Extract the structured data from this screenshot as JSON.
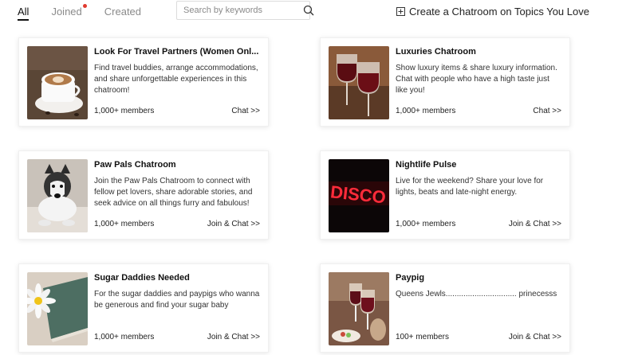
{
  "tabs": [
    {
      "label": "All",
      "active": true
    },
    {
      "label": "Joined",
      "has_notification": true
    },
    {
      "label": "Created"
    }
  ],
  "search": {
    "placeholder": "Search by keywords"
  },
  "create_button": {
    "label": "Create a Chatroom on Topics You Love"
  },
  "chatrooms": [
    {
      "title": "Look For Travel Partners (Women Onl...",
      "description": "Find travel buddies, arrange accommodations, and share unforgettable experiences in this chatroom!",
      "members": "1,000+ members",
      "action": "Chat >>",
      "thumbnail": "coffee-cup-image"
    },
    {
      "title": "Luxuries Chatroom",
      "description": "Show luxury items & share luxury information. Chat with people who have a high taste just like you!",
      "members": "1,000+ members",
      "action": "Chat >>",
      "thumbnail": "wine-glasses-image"
    },
    {
      "title": "Paw Pals Chatroom",
      "description": "Join the Paw Pals Chatroom to connect with fellow pet lovers, share adorable stories, and seek advice on all things furry and fabulous!",
      "members": "1,000+ members",
      "action": "Join & Chat >>",
      "thumbnail": "husky-dog-image"
    },
    {
      "title": "Nightlife Pulse",
      "description": "Live for the weekend? Share your love for lights, beats and late-night energy.",
      "members": "1,000+ members",
      "action": "Join & Chat >>",
      "thumbnail": "disco-neon-sign-image",
      "neon_text": "DISCO"
    },
    {
      "title": "Sugar Daddies Needed",
      "description": "For the sugar daddies and paypigs who wanna be generous and find your sugar baby",
      "members": "1,000+ members",
      "action": "Join & Chat >>",
      "thumbnail": "white-flower-image"
    },
    {
      "title": "Paypig",
      "description": "Queens Jewls................................ prinecesss",
      "members": "100+ members",
      "action": "Join & Chat >>",
      "thumbnail": "champagne-toast-image"
    }
  ],
  "colors": {
    "notification_dot": "#e03a2f",
    "text": "#1f1f1f",
    "muted": "#8a8a8a"
  }
}
